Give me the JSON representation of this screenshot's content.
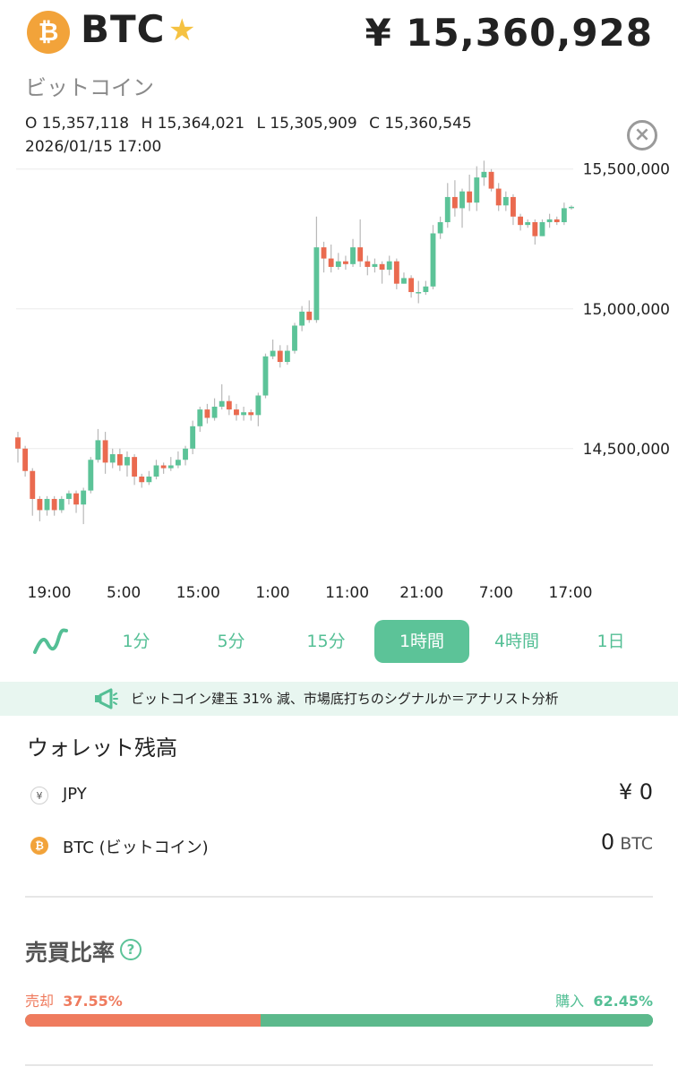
{
  "header": {
    "coin_logo_glyph": "₿",
    "ticker": "BTC",
    "star_icon": "star-icon",
    "price": "¥ 15,360,928",
    "coin_name": "ビットコイン"
  },
  "ohlc": {
    "open": "O 15,357,118",
    "high": "H 15,364,021",
    "low": "L 15,305,909",
    "close": "C 15,360,545",
    "timestamp": "2026/01/15 17:00",
    "close_icon": "close-circle-icon"
  },
  "chart_data": {
    "type": "candlestick",
    "ylim": [
      14150000,
      15560000
    ],
    "y_ticks": [
      {
        "value": 15500000,
        "label": "15,500,000"
      },
      {
        "value": 15000000,
        "label": "15,000,000"
      },
      {
        "value": 14500000,
        "label": "14,500,000"
      }
    ],
    "x_ticks": [
      "19:00",
      "5:00",
      "15:00",
      "1:00",
      "11:00",
      "21:00",
      "7:00",
      "17:00"
    ],
    "up_color": "#5cc398",
    "down_color": "#ea6a4f",
    "candles": [
      [
        14540000,
        14500000,
        14560000,
        14450000
      ],
      [
        14500000,
        14420000,
        14510000,
        14400000
      ],
      [
        14420000,
        14320000,
        14430000,
        14260000
      ],
      [
        14320000,
        14280000,
        14330000,
        14240000
      ],
      [
        14280000,
        14320000,
        14330000,
        14260000
      ],
      [
        14320000,
        14280000,
        14330000,
        14260000
      ],
      [
        14280000,
        14320000,
        14330000,
        14270000
      ],
      [
        14320000,
        14340000,
        14350000,
        14300000
      ],
      [
        14340000,
        14300000,
        14350000,
        14270000
      ],
      [
        14300000,
        14350000,
        14360000,
        14230000
      ],
      [
        14350000,
        14460000,
        14470000,
        14340000
      ],
      [
        14460000,
        14530000,
        14570000,
        14450000
      ],
      [
        14530000,
        14450000,
        14560000,
        14410000
      ],
      [
        14450000,
        14480000,
        14500000,
        14430000
      ],
      [
        14480000,
        14440000,
        14500000,
        14420000
      ],
      [
        14440000,
        14470000,
        14490000,
        14400000
      ],
      [
        14470000,
        14400000,
        14480000,
        14370000
      ],
      [
        14400000,
        14380000,
        14410000,
        14360000
      ],
      [
        14380000,
        14400000,
        14420000,
        14370000
      ],
      [
        14400000,
        14440000,
        14460000,
        14390000
      ],
      [
        14440000,
        14430000,
        14450000,
        14410000
      ],
      [
        14430000,
        14440000,
        14470000,
        14420000
      ],
      [
        14440000,
        14460000,
        14490000,
        14430000
      ],
      [
        14460000,
        14500000,
        14510000,
        14440000
      ],
      [
        14500000,
        14580000,
        14600000,
        14480000
      ],
      [
        14580000,
        14640000,
        14650000,
        14560000
      ],
      [
        14640000,
        14610000,
        14660000,
        14590000
      ],
      [
        14610000,
        14650000,
        14680000,
        14600000
      ],
      [
        14650000,
        14670000,
        14730000,
        14640000
      ],
      [
        14670000,
        14640000,
        14690000,
        14620000
      ],
      [
        14640000,
        14620000,
        14660000,
        14600000
      ],
      [
        14620000,
        14630000,
        14650000,
        14600000
      ],
      [
        14630000,
        14620000,
        14640000,
        14600000
      ],
      [
        14620000,
        14690000,
        14700000,
        14580000
      ],
      [
        14690000,
        14830000,
        14840000,
        14680000
      ],
      [
        14830000,
        14850000,
        14890000,
        14820000
      ],
      [
        14850000,
        14810000,
        14870000,
        14790000
      ],
      [
        14810000,
        14850000,
        14870000,
        14800000
      ],
      [
        14850000,
        14940000,
        14950000,
        14840000
      ],
      [
        14940000,
        14990000,
        15010000,
        14920000
      ],
      [
        14990000,
        14960000,
        15030000,
        14950000
      ],
      [
        14960000,
        15220000,
        15330000,
        14950000
      ],
      [
        15220000,
        15180000,
        15240000,
        15130000
      ],
      [
        15180000,
        15150000,
        15230000,
        15130000
      ],
      [
        15150000,
        15170000,
        15200000,
        15140000
      ],
      [
        15170000,
        15160000,
        15190000,
        15140000
      ],
      [
        15160000,
        15220000,
        15250000,
        15150000
      ],
      [
        15220000,
        15170000,
        15320000,
        15150000
      ],
      [
        15170000,
        15150000,
        15190000,
        15120000
      ],
      [
        15150000,
        15160000,
        15180000,
        15130000
      ],
      [
        15160000,
        15140000,
        15170000,
        15090000
      ],
      [
        15140000,
        15170000,
        15190000,
        15120000
      ],
      [
        15170000,
        15090000,
        15180000,
        15070000
      ],
      [
        15090000,
        15110000,
        15130000,
        15090000
      ],
      [
        15110000,
        15060000,
        15120000,
        15040000
      ],
      [
        15060000,
        15060000,
        15100000,
        15020000
      ],
      [
        15060000,
        15080000,
        15100000,
        15050000
      ],
      [
        15080000,
        15270000,
        15300000,
        15070000
      ],
      [
        15270000,
        15310000,
        15330000,
        15250000
      ],
      [
        15310000,
        15400000,
        15450000,
        15290000
      ],
      [
        15400000,
        15360000,
        15460000,
        15330000
      ],
      [
        15360000,
        15420000,
        15430000,
        15290000
      ],
      [
        15420000,
        15380000,
        15480000,
        15350000
      ],
      [
        15380000,
        15470000,
        15510000,
        15350000
      ],
      [
        15470000,
        15490000,
        15530000,
        15440000
      ],
      [
        15490000,
        15430000,
        15500000,
        15420000
      ],
      [
        15430000,
        15370000,
        15450000,
        15350000
      ],
      [
        15370000,
        15400000,
        15420000,
        15350000
      ],
      [
        15400000,
        15330000,
        15410000,
        15300000
      ],
      [
        15330000,
        15300000,
        15340000,
        15280000
      ],
      [
        15300000,
        15310000,
        15320000,
        15290000
      ],
      [
        15310000,
        15260000,
        15320000,
        15230000
      ],
      [
        15260000,
        15310000,
        15320000,
        15260000
      ],
      [
        15310000,
        15320000,
        15340000,
        15290000
      ],
      [
        15320000,
        15310000,
        15330000,
        15300000
      ],
      [
        15310000,
        15360000,
        15380000,
        15300000
      ],
      [
        15360000,
        15365000,
        15370000,
        15355000
      ]
    ]
  },
  "tabs": {
    "line_icon": "line-chart-icon",
    "items": [
      {
        "label": "1分"
      },
      {
        "label": "5分"
      },
      {
        "label": "15分"
      },
      {
        "label": "1時間"
      },
      {
        "label": "4時間"
      },
      {
        "label": "1日"
      }
    ],
    "active": "1時間"
  },
  "news": {
    "icon": "megaphone-icon",
    "text": "ビットコイン建玉 31% 減、市場底打ちのシグナルか＝アナリスト分析"
  },
  "wallet": {
    "title": "ウォレット残高",
    "rows": [
      {
        "icon": "yen-icon",
        "glyph": "¥",
        "label": "JPY",
        "amount": "¥ 0",
        "unit": ""
      },
      {
        "icon": "bitcoin-icon",
        "glyph": "₿",
        "label": "BTC (ビットコイン)",
        "amount": "0",
        "unit": "BTC"
      }
    ]
  },
  "ratio": {
    "title": "売買比率",
    "help_icon": "help-icon",
    "help_glyph": "?",
    "sell_label": "売却",
    "sell_value": "37.55%",
    "sell_fraction": 0.3755,
    "buy_label": "購入",
    "buy_value": "62.45%",
    "buy_fraction": 0.6245,
    "sell_color": "#ef7b5e",
    "buy_color": "#5cb98c"
  }
}
